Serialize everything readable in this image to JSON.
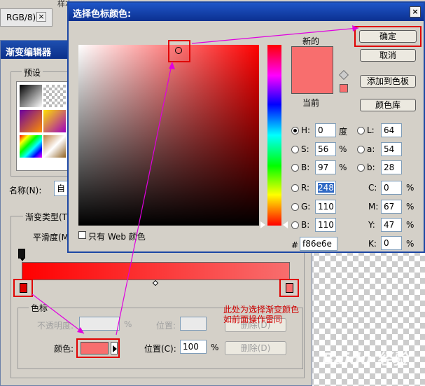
{
  "background": {
    "doc_tab_label": "RGB/8)",
    "doc_tab_close": "×",
    "top_menu_fragment": "样本:"
  },
  "gradient_editor": {
    "title": "渐变编辑器",
    "presets_legend": "预设",
    "name_label": "名称(N):",
    "name_value": "自",
    "gradient_type_label": "渐变类型(T",
    "smoothness_label": "平滑度(M",
    "color_stop_legend": "色标",
    "opacity_label": "不透明度:",
    "opacity_unit": "%",
    "position_label_top": "位置:",
    "delete_label_top": "删除(D)",
    "color_label": "颜色:",
    "color_swatch_hex": "#f86e6e",
    "position_label": "位置(C):",
    "position_value": "100",
    "position_unit": "%",
    "delete_label": "删除(D)",
    "annotation_line1": "此处为选择渐变颜色",
    "annotation_line2": "如前面操作雷同",
    "gradient_start": "#ff0000",
    "gradient_end": "#f86e6e",
    "preset_swatches": [
      "bw",
      "transparent",
      "black",
      "violet-orange",
      "yellow-purple",
      "rainbow"
    ]
  },
  "color_picker": {
    "title": "选择色标颜色:",
    "close_glyph": "×",
    "new_label": "新的",
    "current_label": "当前",
    "new_color": "#f86e6e",
    "current_color": "#f86e6e",
    "ok_label": "确定",
    "cancel_label": "取消",
    "add_swatch_label": "添加到色板",
    "libraries_label": "颜色库",
    "web_only_label": "只有 Web 颜色",
    "hsb": {
      "h_label": "H:",
      "h_value": "0",
      "h_unit": "度",
      "s_label": "S:",
      "s_value": "56",
      "s_unit": "%",
      "b_label": "B:",
      "b_value": "97",
      "b_unit": "%"
    },
    "lab": {
      "l_label": "L:",
      "l_value": "64",
      "a_label": "a:",
      "a_value": "54",
      "b_label": "b:",
      "b_value": "28"
    },
    "rgb": {
      "r_label": "R:",
      "r_value": "248",
      "g_label": "G:",
      "g_value": "110",
      "b_label": "B:",
      "b_value": "110"
    },
    "cmyk": {
      "c_label": "C:",
      "c_value": "0",
      "c_unit": "%",
      "m_label": "M:",
      "m_value": "67",
      "m_unit": "%",
      "y_label": "Y:",
      "y_value": "47",
      "y_unit": "%",
      "k_label": "K:",
      "k_value": "0",
      "k_unit": "%"
    },
    "hex_label": "#",
    "hex_value": "f86e6e"
  },
  "annotation_color": "#e000e0",
  "highlight_color": "#e00000",
  "watermark": "Baidu 经验"
}
